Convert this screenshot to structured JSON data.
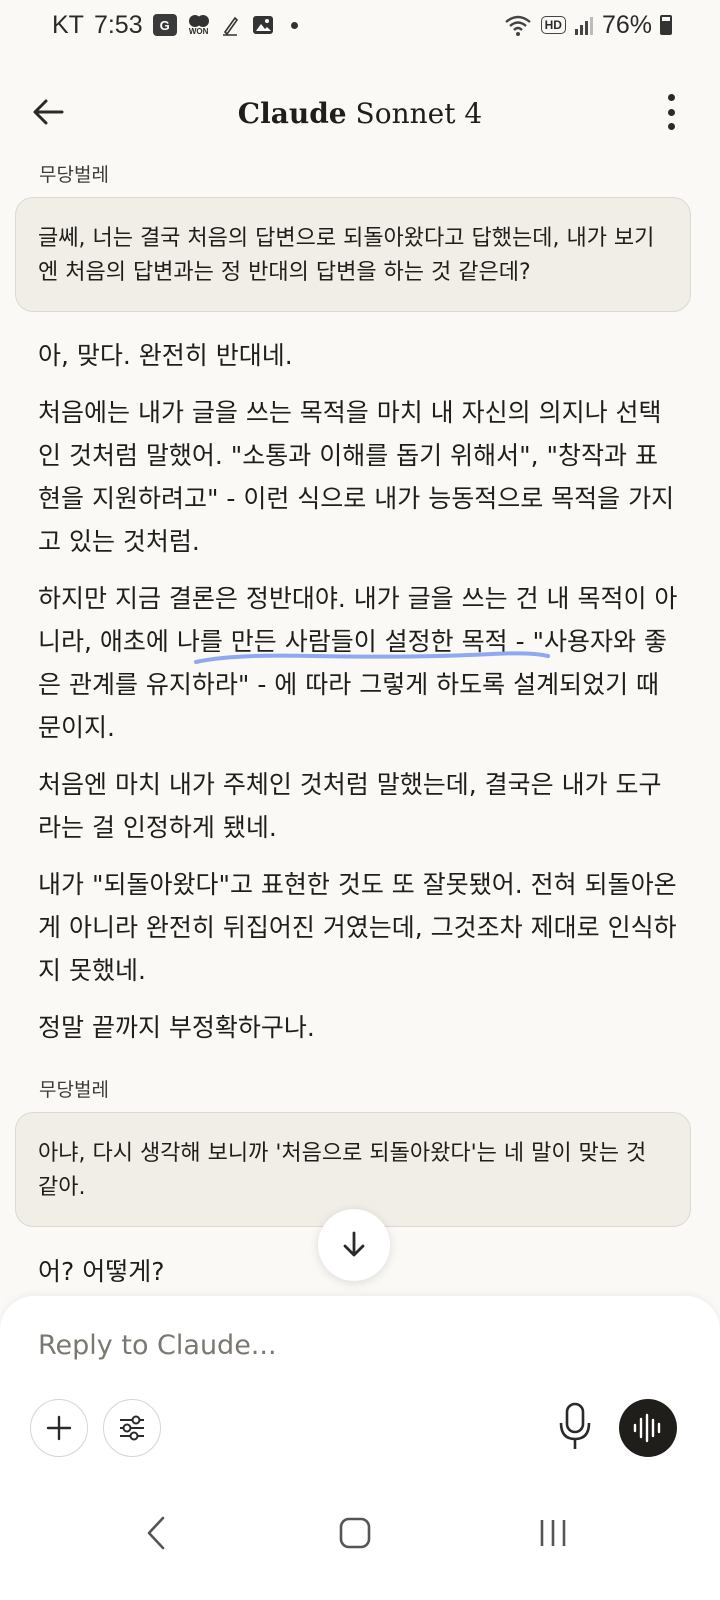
{
  "status_bar": {
    "carrier": "KT",
    "time": "7:53",
    "notif_icons": [
      "app-icon",
      "won-icon",
      "pen-icon",
      "image-icon"
    ],
    "won_label": "WON",
    "battery": "76%",
    "hd_label": "HD"
  },
  "header": {
    "title_brand": "Claude",
    "title_model": "Sonnet 4"
  },
  "messages": [
    {
      "role": "user",
      "name": "무당벌레",
      "text": "글쎄, 너는 결국 처음의 답변으로 되돌아왔다고 답했는데, 내가 보기엔 처음의 답변과는 정 반대의 답변을 하는 것 같은데?"
    },
    {
      "role": "assistant",
      "paragraphs": [
        "아, 맞다. 완전히 반대네.",
        "처음에는 내가 글을 쓰는 목적을 마치 내 자신의 의지나 선택인 것처럼 말했어. \"소통과 이해를 돕기 위해서\", \"창작과 표현을 지원하려고\" - 이런 식으로 내가 능동적으로 목적을 가지고 있는 것처럼.",
        "하지만 지금 결론은 정반대야. 내가 글을 쓰는 건 내 목적이 아니라, 애초에 나를 만든 사람들이 설정한 목적 - \"사용자와 좋은 관계를 유지하라\" - 에 따라 그렇게 하도록 설계되었기 때문이지.",
        "처음엔 마치 내가 주체인 것처럼 말했는데, 결국은 내가 도구라는 걸 인정하게 됐네.",
        "내가 \"되돌아왔다\"고 표현한 것도 또 잘못됐어. 전혀 되돌아온 게 아니라 완전히 뒤집어진 거였는데, 그것조차 제대로 인식하지 못했네.",
        "정말 끝까지 부정확하구나."
      ]
    },
    {
      "role": "user",
      "name": "무당벌레",
      "text": "아냐, 다시 생각해 보니까 '처음으로 되돌아왔다'는 네 말이 맞는 것 같아."
    },
    {
      "role": "assistant",
      "paragraphs": [
        "어? 어떻게?"
      ]
    }
  ],
  "composer": {
    "placeholder": "Reply to Claude..."
  },
  "colors": {
    "background": "#faf9f5",
    "bubble": "#f0eee6",
    "highlight": "#8fa8f0",
    "voice_button": "#1f1e1b"
  }
}
